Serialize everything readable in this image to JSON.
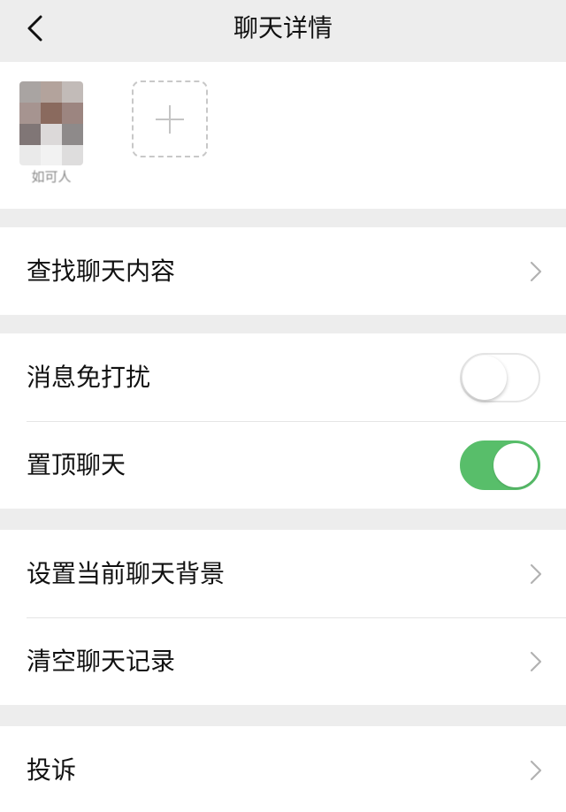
{
  "header": {
    "title": "聊天详情",
    "back_icon": "chevron-left-icon"
  },
  "members": {
    "items": [
      {
        "name": "如可人"
      }
    ],
    "add_icon": "plus-icon"
  },
  "settings": {
    "search_history": {
      "label": "查找聊天内容",
      "icon": "chevron-right-icon"
    },
    "mute": {
      "label": "消息免打扰",
      "enabled": false
    },
    "pin": {
      "label": "置顶聊天",
      "enabled": true
    },
    "background": {
      "label": "设置当前聊天背景",
      "icon": "chevron-right-icon"
    },
    "clear_history": {
      "label": "清空聊天记录",
      "icon": "chevron-right-icon"
    },
    "report": {
      "label": "投诉",
      "icon": "chevron-right-icon"
    }
  },
  "colors": {
    "background": "#ededed",
    "toggle_on": "#58be6a",
    "divider": "#e5e5e5"
  }
}
